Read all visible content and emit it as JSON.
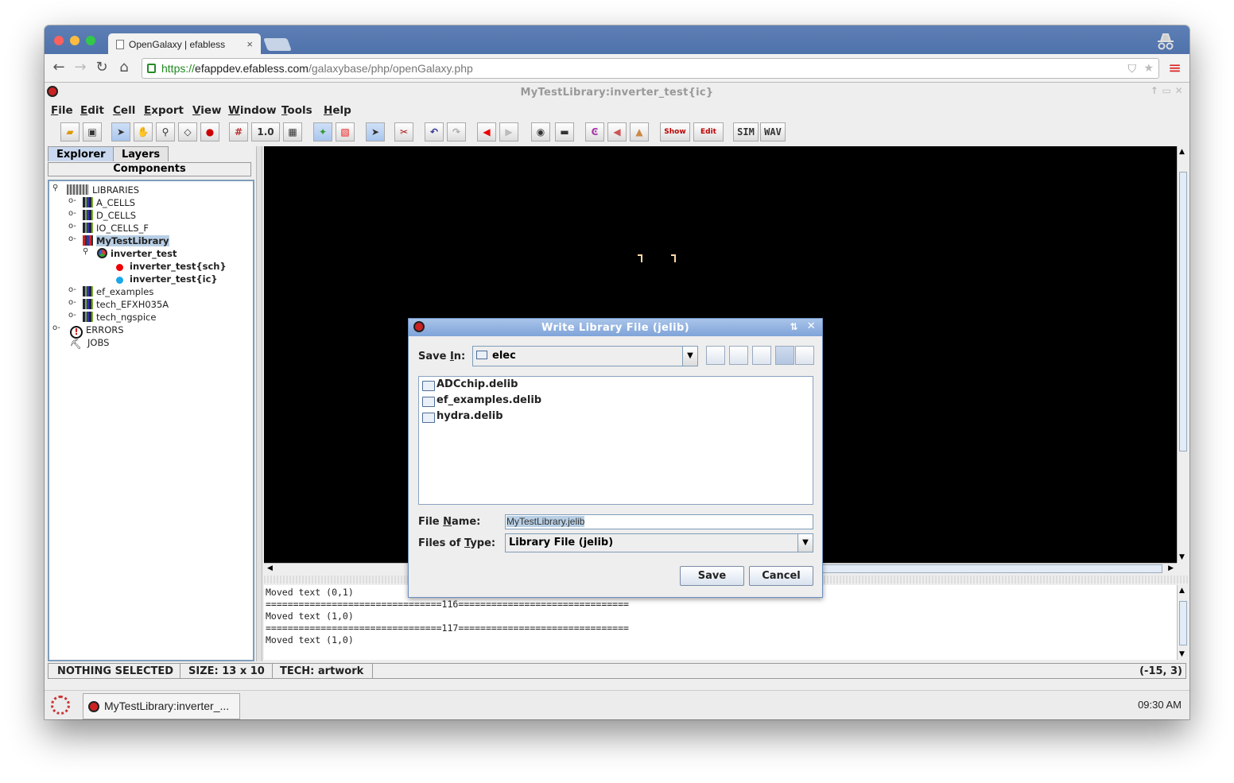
{
  "browser": {
    "tab_title": "OpenGalaxy | efabless",
    "tab_close": "×",
    "url_scheme": "https://",
    "url_host": "efappdev.efabless.com",
    "url_path": "/galaxybase/php/openGalaxy.php",
    "nav_icons": [
      "back-arrow-icon",
      "forward-arrow-icon",
      "reload-icon",
      "home-icon"
    ]
  },
  "app": {
    "window_title": "MyTestLibrary:inverter_test{ic}",
    "menus": [
      {
        "mn": "F",
        "rest": "ile"
      },
      {
        "mn": "E",
        "rest": "dit"
      },
      {
        "mn": "C",
        "rest": "ell"
      },
      {
        "mn": "E",
        "rest": "xport"
      },
      {
        "mn": "V",
        "rest": "iew"
      },
      {
        "mn": "W",
        "rest": "indow"
      },
      {
        "mn": "T",
        "rest": "ools"
      },
      {
        "mn": "H",
        "rest": "elp"
      }
    ],
    "toolbar": {
      "scale": "1.0",
      "show": "Show",
      "edit": "Edit",
      "sim": "SIM",
      "wav": "WAV"
    }
  },
  "side": {
    "tab_explorer": "Explorer",
    "tab_layers": "Layers",
    "components": "Components",
    "tree": {
      "libraries": "LIBRARIES",
      "a_cells": "A_CELLS",
      "d_cells": "D_CELLS",
      "io_cells": "IO_CELLS_F",
      "mytestlib": "MyTestLibrary",
      "inverter_test": "inverter_test",
      "sch": "inverter_test{sch}",
      "ic": "inverter_test{ic}",
      "ef_examples": "ef_examples",
      "tech_efx": "tech_EFXH035A",
      "tech_ngspice": "tech_ngspice",
      "errors": "ERRORS",
      "jobs": "JOBS"
    }
  },
  "log_text": "Moved text (0,1)\n================================116===============================\nMoved text (1,0)\n================================117===============================\nMoved text (1,0)",
  "status": {
    "selection": "NOTHING SELECTED",
    "size": "SIZE: 13 x 10",
    "tech": "TECH: artwork",
    "coords": "(-15, 3)"
  },
  "taskbar": {
    "task_label": "MyTestLibrary:inverter_...",
    "clock": "09:30 AM"
  },
  "dialog": {
    "title": "Write Library File (jelib)",
    "save_in_label": {
      "pre": "Save ",
      "mn": "I",
      "post": "n:"
    },
    "save_in_value": "elec",
    "files": [
      "ADCchip.delib",
      "ef_examples.delib",
      "hydra.delib"
    ],
    "file_name_label": {
      "pre": "File ",
      "mn": "N",
      "post": "ame:"
    },
    "file_name_value": "MyTestLibrary.jelib",
    "files_of_type_label": {
      "pre": "Files of ",
      "mn": "T",
      "post": "ype:"
    },
    "files_of_type_value": "Library File (jelib)",
    "save_button": "Save",
    "cancel_button": "Cancel"
  }
}
